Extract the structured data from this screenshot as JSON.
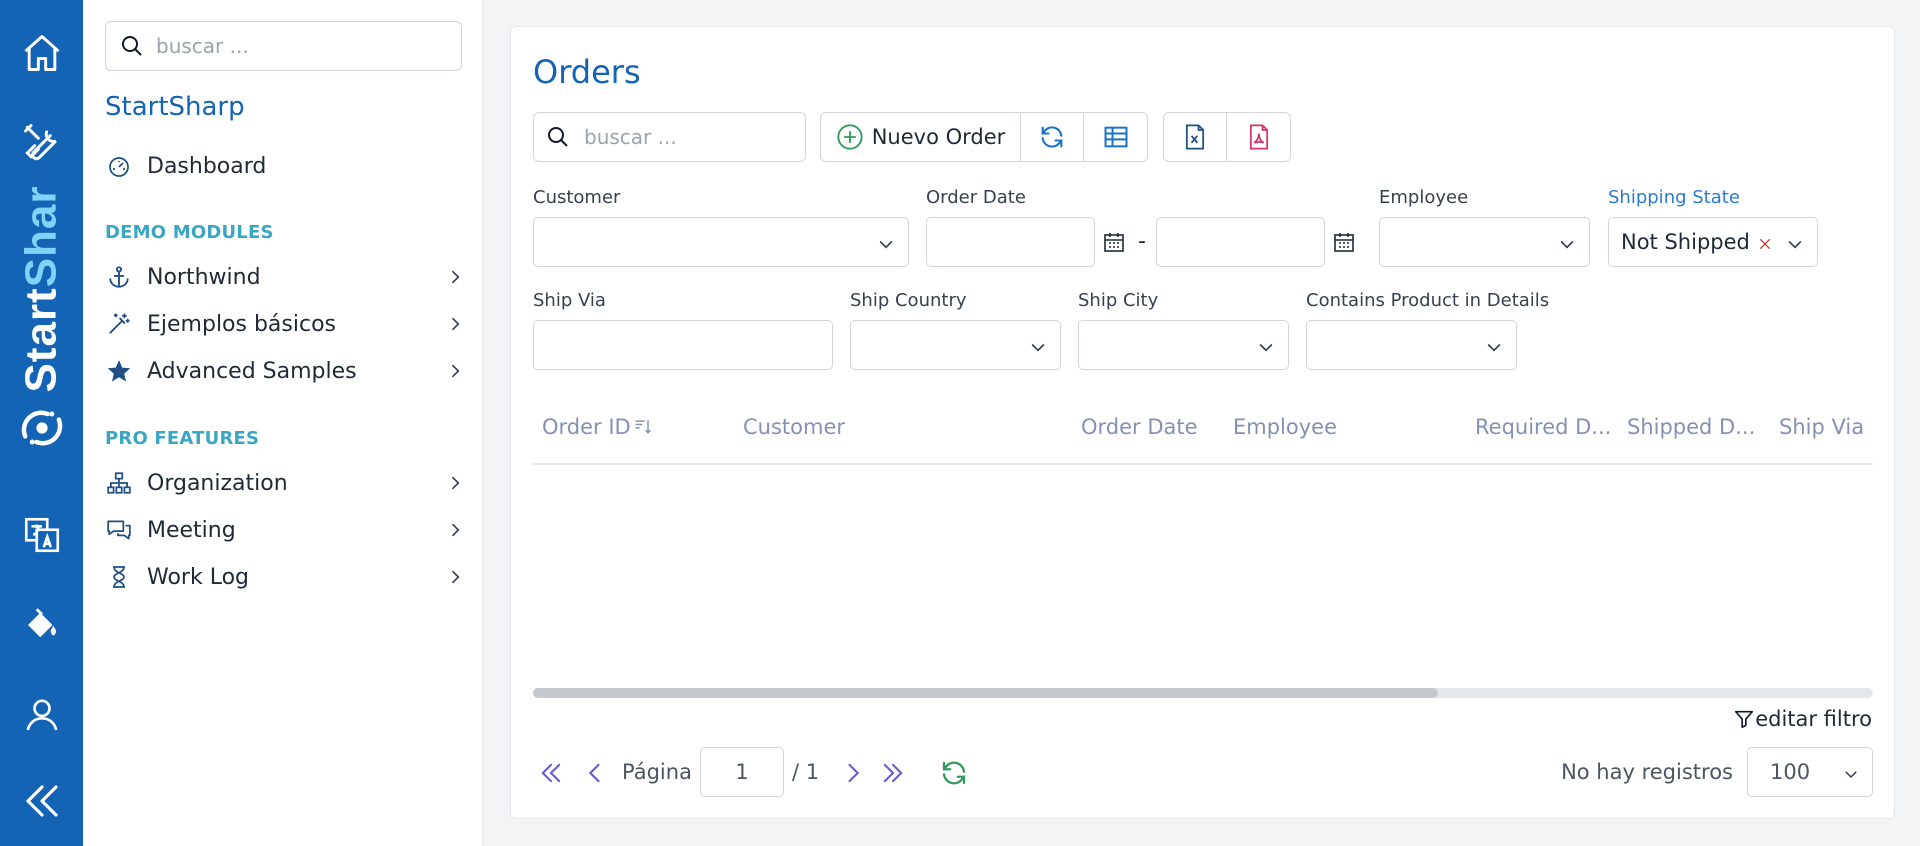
{
  "rail": {
    "brand": "StartShar",
    "icons": [
      "home-icon",
      "tools-icon",
      "logo-icon",
      "translate-icon",
      "paint-bucket-icon",
      "user-icon",
      "collapse-icon"
    ]
  },
  "sidebar": {
    "search_placeholder": "buscar ...",
    "app_title": "StartSharp",
    "dashboard_label": "Dashboard",
    "demo_section": "DEMO MODULES",
    "demo_items": [
      "Northwind",
      "Ejemplos básicos",
      "Advanced Samples"
    ],
    "pro_section": "PRO FEATURES",
    "pro_items": [
      "Organization",
      "Meeting",
      "Work Log"
    ]
  },
  "main": {
    "title": "Orders",
    "search_placeholder": "buscar ...",
    "new_button": "Nuevo Order",
    "filters": {
      "customer_label": "Customer",
      "order_date_label": "Order Date",
      "date_separator": "-",
      "employee_label": "Employee",
      "shipping_state_label": "Shipping State",
      "shipping_state_value": "Not Shipped",
      "ship_via_label": "Ship Via",
      "ship_country_label": "Ship Country",
      "ship_city_label": "Ship City",
      "contains_product_label": "Contains Product in Details"
    },
    "columns": [
      "Order ID",
      "Customer",
      "Order Date",
      "Employee",
      "Required D...",
      "Shipped D...",
      "Ship Via"
    ],
    "edit_filter": "editar filtro",
    "pager": {
      "page_label": "Página",
      "page_value": "1",
      "total": "/ 1",
      "status": "No hay registros",
      "page_size": "100"
    }
  },
  "colors": {
    "brand_blue": "#1364b5",
    "section_teal": "#3aa6c2",
    "header_text": "#8591b4",
    "pager_purple": "#6d5bd0",
    "refresh_green": "#2e9a5e"
  }
}
